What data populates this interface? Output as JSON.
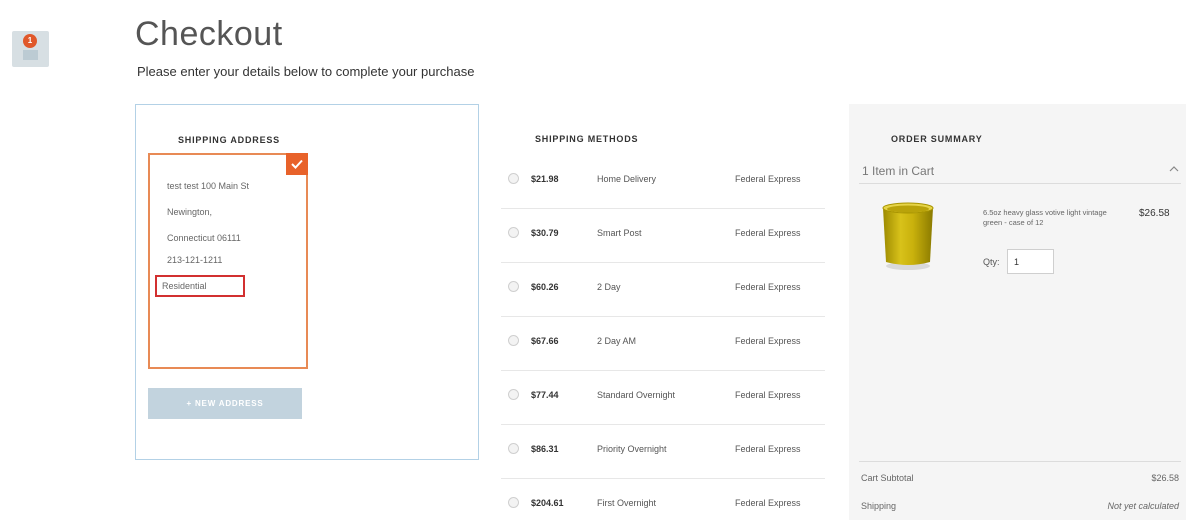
{
  "header": {
    "title": "Checkout",
    "subtitle": "Please enter your details below to complete your purchase",
    "cart_badge_count": "1"
  },
  "shipping_address": {
    "heading": "SHIPPING ADDRESS",
    "selected_address": {
      "street": "test test 100 Main St",
      "city": "Newington,",
      "state_zip": "Connecticut 06111",
      "phone": "213-121-1211",
      "type": "Residential"
    },
    "new_address_label": "+ NEW ADDRESS"
  },
  "shipping_methods": {
    "heading": "SHIPPING METHODS",
    "rows": [
      {
        "price": "$21.98",
        "name": "Home Delivery",
        "carrier": "Federal Express"
      },
      {
        "price": "$30.79",
        "name": "Smart Post",
        "carrier": "Federal Express"
      },
      {
        "price": "$60.26",
        "name": "2 Day",
        "carrier": "Federal Express"
      },
      {
        "price": "$67.66",
        "name": "2 Day AM",
        "carrier": "Federal Express"
      },
      {
        "price": "$77.44",
        "name": "Standard Overnight",
        "carrier": "Federal Express"
      },
      {
        "price": "$86.31",
        "name": "Priority Overnight",
        "carrier": "Federal Express"
      },
      {
        "price": "$204.61",
        "name": "First Overnight",
        "carrier": "Federal Express"
      }
    ]
  },
  "order_summary": {
    "heading": "ORDER SUMMARY",
    "items_count": "1 Item in Cart",
    "item": {
      "name": "6.5oz heavy glass votive light vintage green - case of 12",
      "price": "$26.58",
      "qty_label": "Qty:",
      "qty_value": "1"
    },
    "totals": [
      {
        "label": "Cart Subtotal",
        "value": "$26.58"
      },
      {
        "label": "Shipping",
        "value": "Not yet calculated"
      }
    ]
  },
  "colors": {
    "accent": "#e8622a",
    "highlight_border": "#d23030",
    "panel_border": "#b3d1e6"
  }
}
